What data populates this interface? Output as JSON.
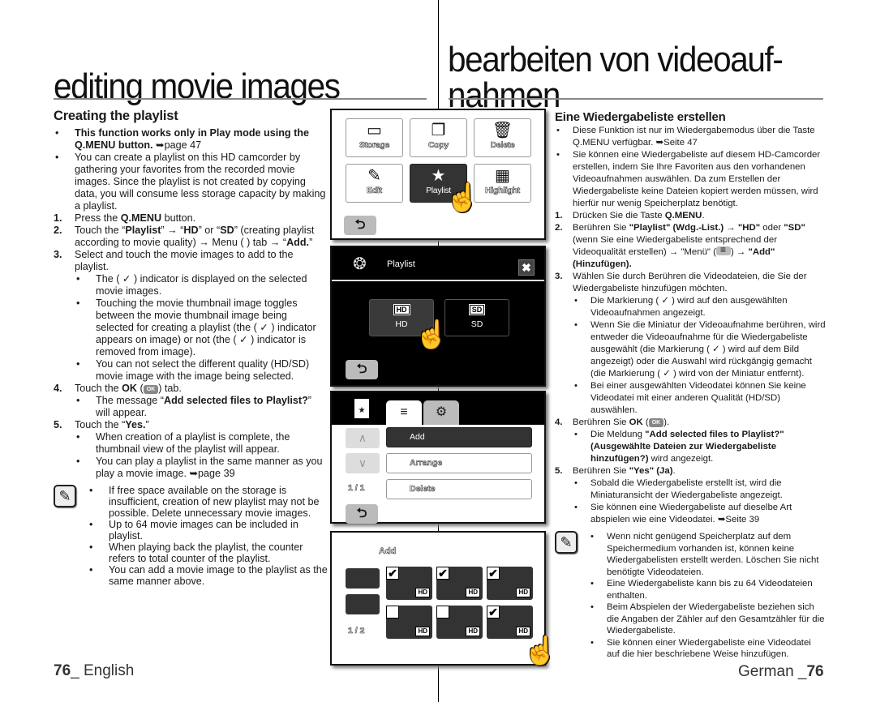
{
  "titles": {
    "en": "editing movie images",
    "de_line1": "bearbeiten von videoauf-",
    "de_line2": "nahmen"
  },
  "en": {
    "heading": "Creating the playlist",
    "intro": [
      {
        "bold": "This function works only in Play mode using the Q.MENU button.",
        "ref": " ➥page 47"
      },
      {
        "text": " You can create a playlist on this HD camcorder by gathering your favorites from the recorded movie images. Since the playlist is not created by copying data, you will consume less storage capacity by making a playlist."
      }
    ],
    "steps": {
      "s1": {
        "num": "1.",
        "pre": "Press the ",
        "bold": "Q.MENU",
        "post": " button."
      },
      "s2": {
        "num": "2.",
        "t1": "Touch the “",
        "b1": "Playlist",
        "t2": "” → “",
        "b2": "HD",
        "t3": "” or “",
        "b3": "SD",
        "t4": "” (creating playlist according to movie quality) → Menu (      ) tab → “",
        "b4": "Add.",
        "t5": "”"
      },
      "s3": {
        "num": "3.",
        "text": "Select and touch the movie images to add to the playlist.",
        "bullets": [
          "The ( ✓ ) indicator is displayed on the selected movie images.",
          "Touching the movie thumbnail image toggles between the movie thumbnail image being selected for creating a playlist (the ( ✓ ) indicator appears on image) or not (the ( ✓ ) indicator is removed from image).",
          "You can not select the different quality (HD/SD) movie image with the image being selected."
        ]
      },
      "s4": {
        "num": "4.",
        "pre": "Touch the ",
        "bold": "OK",
        "mid": " (",
        "chip": "OK",
        "post": ") tab.",
        "bullet_pre": "The message “",
        "bullet_bold": "Add selected files to Playlist?",
        "bullet_post": "” will appear."
      },
      "s5": {
        "num": "5.",
        "pre": "Touch the “",
        "bold": "Yes.",
        "post": "”",
        "bullets": [
          "When creation of a playlist is complete, the thumbnail view of the playlist will appear.",
          "You can play a playlist in the same manner as you play a movie image. ➥page 39"
        ]
      }
    },
    "notes": [
      "If free space available on the storage is insufficient, creation of new playlist may not be possible. Delete unnecessary movie images.",
      "Up to 64 movie images can be included in playlist.",
      "When playing back the playlist, the counter refers to total counter of the playlist.",
      "You can add a movie image to the playlist as the same manner above."
    ],
    "footer_num": "76",
    "footer_lang": "_ English"
  },
  "de": {
    "heading": "Eine Wiedergabeliste erstellen",
    "intro": [
      "Diese Funktion ist nur im Wiedergabemodus über die Taste Q.MENU verfügbar. ➥Seite 47",
      "Sie können eine Wiedergabeliste auf diesem HD-Camcorder erstellen, indem Sie Ihre Favoriten aus den vorhandenen Videoaufnahmen auswählen. Da zum Erstellen der Wiedergabeliste keine Dateien kopiert werden müssen, wird hierfür nur wenig Speicherplatz benötigt."
    ],
    "steps": {
      "s1": {
        "num": "1.",
        "pre": "Drücken Sie die Taste ",
        "bold": "Q.MENU",
        "post": "."
      },
      "s2": {
        "num": "2.",
        "t1": "Berühren Sie ",
        "b1": "\"Playlist\" (Wdg.-List.)",
        "t2": " → ",
        "b2": "\"HD\"",
        "t3": " oder ",
        "b3": "\"SD\"",
        "t4": " (wenn Sie eine Wiedergabeliste entsprechend der Videoqualität erstellen) → \"Menü\" (",
        "t5": ") → ",
        "b4": "\"Add\" (Hinzufügen)."
      },
      "s3": {
        "num": "3.",
        "text": "Wählen Sie durch Berühren die Videodateien, die Sie der Wiedergabeliste hinzufügen möchten.",
        "bullets": [
          "Die Markierung ( ✓ ) wird auf den ausgewählten Videoaufnahmen angezeigt.",
          "Wenn Sie die Miniatur der Videoaufnahme berühren, wird entweder die Videoaufnahme für die Wiedergabeliste ausgewählt (die Markierung ( ✓ ) wird auf dem Bild angezeigt) oder die Auswahl wird rückgängig gemacht (die Markierung ( ✓ ) wird von der Miniatur entfernt).",
          "Bei einer ausgewählten Videodatei können Sie keine Videodatei mit einer anderen Qualität (HD/SD) auswählen."
        ]
      },
      "s4": {
        "num": "4.",
        "pre": "Berühren Sie ",
        "bold": "OK",
        "mid": " (",
        "chip": "OK",
        "post": ").",
        "bullet_pre": "Die Meldung ",
        "bullet_bold": "\"Add selected files to Playlist?\" (Ausgewählte Dateien zur Wiedergabeliste hinzufügen?)",
        "bullet_post": " wird angezeigt."
      },
      "s5": {
        "num": "5.",
        "pre": "Berühren Sie ",
        "bold": "\"Yes\" (Ja)",
        "post": ".",
        "bullets": [
          "Sobald die Wiedergabeliste erstellt ist, wird die Miniaturansicht der Wiedergabeliste angezeigt.",
          "Sie können eine Wiedergabeliste auf dieselbe Art abspielen wie eine Videodatei. ➥Seite 39"
        ]
      }
    },
    "notes": [
      "Wenn nicht genügend Speicherplatz auf dem Speichermedium vorhanden ist, können keine Wiedergabelisten erstellt werden. Löschen Sie nicht benötigte Videodateien.",
      "Eine Wiedergabeliste kann bis zu 64 Videodateien enthalten.",
      "Beim Abspielen der Wiedergabeliste beziehen sich die Angaben der Zähler auf den Gesamtzähler für die Wiedergabeliste.",
      "Sie können einer Wiedergabeliste eine Videodatei auf die hier beschriebene Weise hinzufügen."
    ],
    "footer_lang": "German _",
    "footer_num": "76"
  },
  "screens": {
    "s1": {
      "tiles": [
        {
          "label": "Storage",
          "icon": "sd-card-icon"
        },
        {
          "label": "Copy",
          "icon": "copy-icon"
        },
        {
          "label": "Delete",
          "icon": "trash-icon"
        },
        {
          "label": "Edit",
          "icon": "pencil-icon"
        },
        {
          "label": "Playlist",
          "icon": "playlist-file-icon",
          "selected": true
        },
        {
          "label": "Highlight",
          "icon": "film-strip-icon"
        }
      ],
      "back": "⮌"
    },
    "s2": {
      "title": "Playlist",
      "close": "✖",
      "options": [
        {
          "badge": "HD",
          "label": "HD",
          "selected": true
        },
        {
          "badge": "SD",
          "label": "SD"
        }
      ]
    },
    "s3": {
      "menu": [
        {
          "label": "Add",
          "selected": true
        },
        {
          "label": "Arrange"
        },
        {
          "label": "Delete"
        }
      ],
      "page": "1 / 1"
    },
    "s4": {
      "title": "Add",
      "page": "1 / 2",
      "thumbs": [
        {
          "checked": true,
          "badge": "HD"
        },
        {
          "checked": true,
          "badge": "HD"
        },
        {
          "checked": true,
          "badge": "HD"
        },
        {
          "checked": false,
          "badge": "HD"
        },
        {
          "checked": false,
          "badge": "HD"
        },
        {
          "checked": true,
          "badge": "HD"
        }
      ]
    }
  },
  "glyphs": {
    "bullet": "•",
    "check": "✔",
    "note": "✎",
    "up": "∧",
    "down": "∨",
    "star": "★",
    "gear": "⚙",
    "menu": "≡",
    "hand": "☝",
    "reel": "❂",
    "sd": "▭",
    "copy": "❐",
    "trash": "🗑",
    "pencil": "✎",
    "film": "▦"
  }
}
